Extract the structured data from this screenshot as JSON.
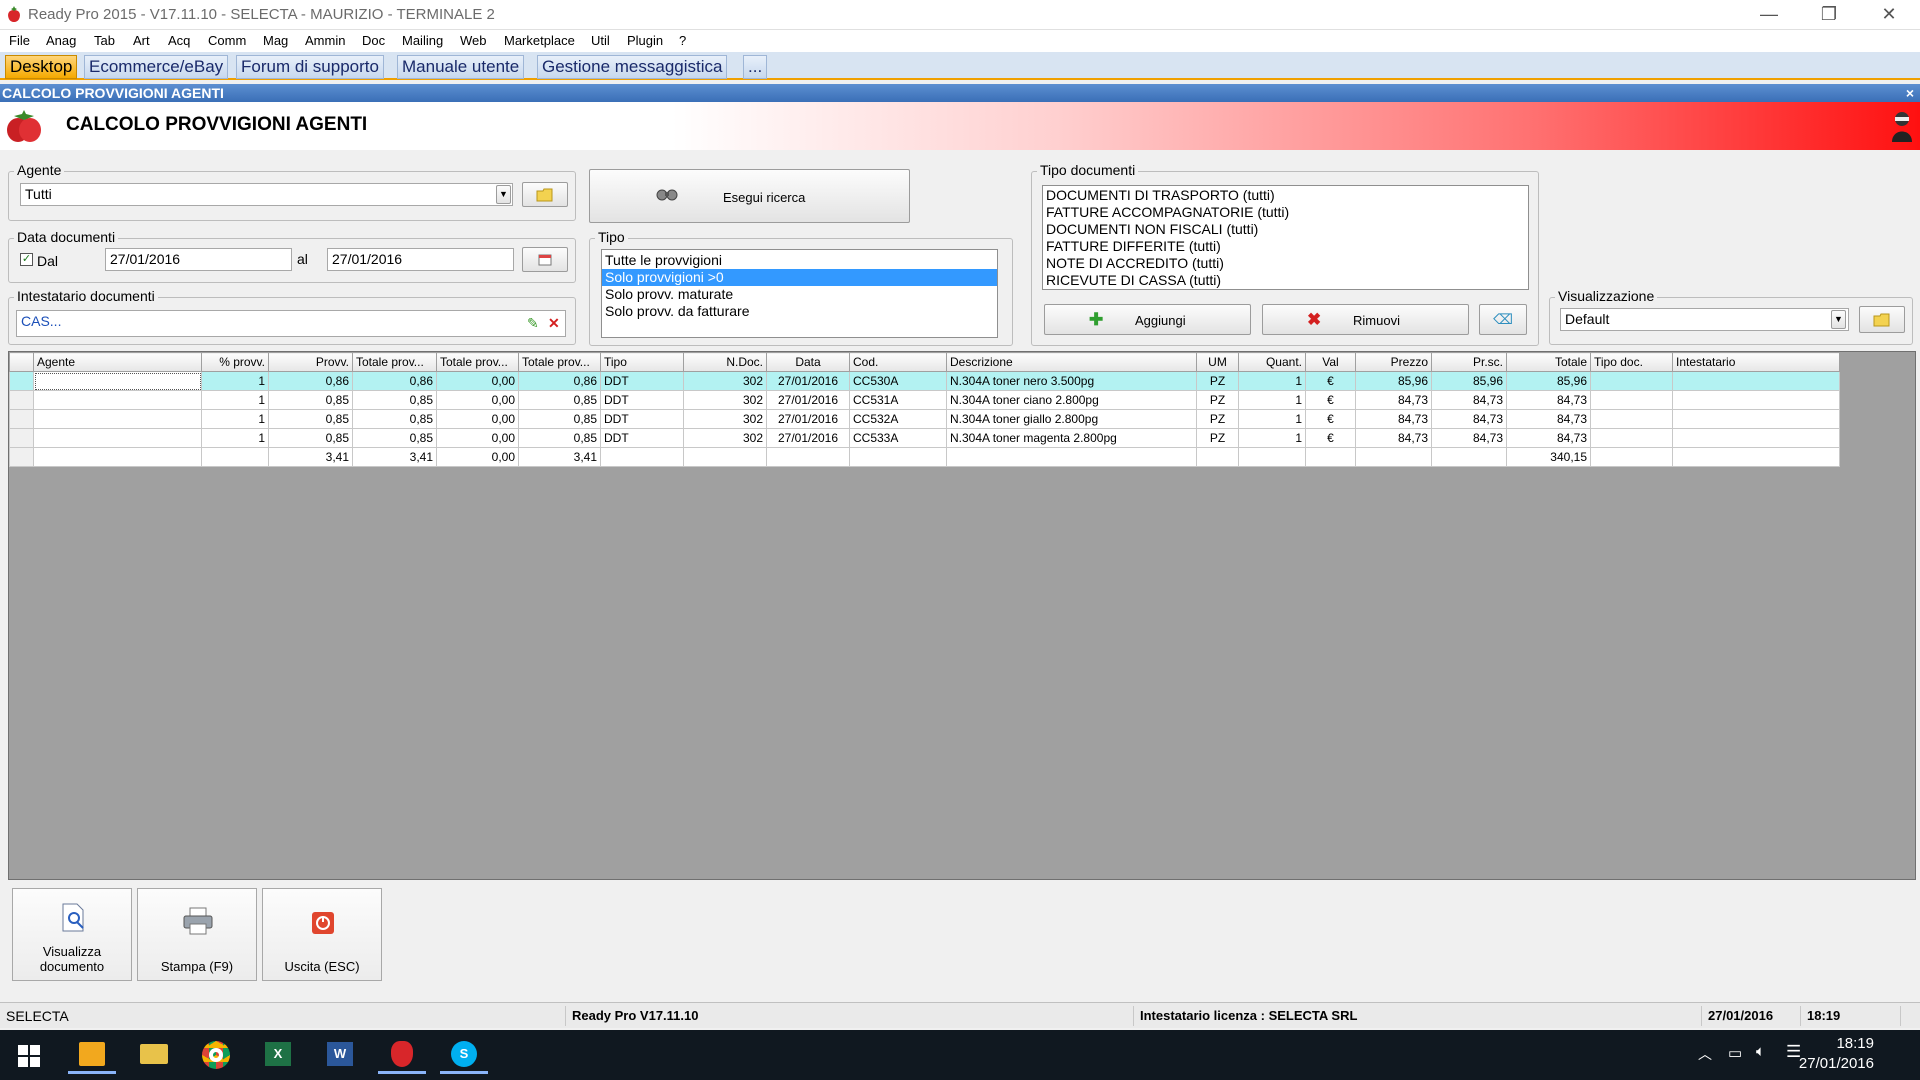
{
  "window": {
    "title": "Ready Pro 2015 - V17.11.10 - SELECTA - MAURIZIO - TERMINALE 2",
    "minimize": "—",
    "restore": "❐",
    "close": "✕"
  },
  "menu": [
    "File",
    "Anag",
    "Tab",
    "Art",
    "Acq",
    "Comm",
    "Mag",
    "Ammin",
    "Doc",
    "Mailing",
    "Web",
    "Marketplace",
    "Util",
    "Plugin",
    "?"
  ],
  "tabs": [
    "Desktop",
    "Ecommerce/eBay",
    "Forum di supporto",
    "Manuale utente",
    "Gestione messaggistica",
    "..."
  ],
  "form_strip": {
    "title": "CALCOLO PROVVIGIONI AGENTI",
    "close": "×"
  },
  "banner": {
    "title": "CALCOLO PROVVIGIONI AGENTI"
  },
  "agente": {
    "label": "Agente",
    "value": "Tutti"
  },
  "data_documenti": {
    "label": "Data documenti",
    "dal_label": "Dal",
    "dal_checked": true,
    "dal_value": "27/01/2016",
    "al_label": "al",
    "al_value": "27/01/2016"
  },
  "intestatario": {
    "label": "Intestatario documenti",
    "value": "CAS..."
  },
  "esegui": {
    "label": "Esegui ricerca"
  },
  "tipo": {
    "label": "Tipo",
    "options": [
      "Tutte le provvigioni",
      "Solo provvigioni >0",
      "Solo provv. maturate",
      "Solo provv. da fatturare"
    ],
    "selected_index": 1
  },
  "tipo_documenti": {
    "label": "Tipo documenti",
    "items": [
      "DOCUMENTI DI TRASPORTO (tutti)",
      "FATTURE ACCOMPAGNATORIE (tutti)",
      "DOCUMENTI NON FISCALI (tutti)",
      "FATTURE DIFFERITE (tutti)",
      "NOTE DI ACCREDITO (tutti)",
      "RICEVUTE DI CASSA (tutti)"
    ],
    "aggiungi": "Aggiungi",
    "rimuovi": "Rimuovi"
  },
  "visualizzazione": {
    "label": "Visualizzazione",
    "value": "Default"
  },
  "grid": {
    "columns": [
      "Agente",
      "% provv.",
      "Provv.",
      "Totale prov...",
      "Totale prov...",
      "Totale prov...",
      "Tipo",
      "N.Doc.",
      "Data",
      "Cod.",
      "Descrizione",
      "UM",
      "Quant.",
      "Val",
      "Prezzo",
      "Pr.sc.",
      "Totale",
      "Tipo doc.",
      "Intestatario"
    ],
    "rows": [
      [
        "",
        "1",
        "0,86",
        "0,86",
        "0,00",
        "0,86",
        "DDT",
        "302",
        "27/01/2016",
        "CC530A",
        "N.304A toner nero 3.500pg",
        "PZ",
        "1",
        "€",
        "85,96",
        "85,96",
        "85,96",
        "",
        ""
      ],
      [
        "",
        "1",
        "0,85",
        "0,85",
        "0,00",
        "0,85",
        "DDT",
        "302",
        "27/01/2016",
        "CC531A",
        "N.304A toner ciano 2.800pg",
        "PZ",
        "1",
        "€",
        "84,73",
        "84,73",
        "84,73",
        "",
        ""
      ],
      [
        "",
        "1",
        "0,85",
        "0,85",
        "0,00",
        "0,85",
        "DDT",
        "302",
        "27/01/2016",
        "CC532A",
        "N.304A toner giallo 2.800pg",
        "PZ",
        "1",
        "€",
        "84,73",
        "84,73",
        "84,73",
        "",
        ""
      ],
      [
        "",
        "1",
        "0,85",
        "0,85",
        "0,00",
        "0,85",
        "DDT",
        "302",
        "27/01/2016",
        "CC533A",
        "N.304A toner magenta 2.800pg",
        "PZ",
        "1",
        "€",
        "84,73",
        "84,73",
        "84,73",
        "",
        ""
      ]
    ],
    "totals": [
      "",
      "",
      "3,41",
      "3,41",
      "0,00",
      "3,41",
      "",
      "",
      "",
      "",
      "",
      "",
      "",
      "",
      "",
      "",
      "340,15",
      "",
      ""
    ]
  },
  "actions": {
    "visualizza": "Visualizza documento",
    "stampa": "Stampa (F9)",
    "uscita": "Uscita (ESC)"
  },
  "statusbar": {
    "company": "SELECTA",
    "version": "Ready Pro V17.11.10",
    "license": "Intestatario licenza : SELECTA SRL",
    "date": "27/01/2016",
    "time": "18:19"
  },
  "taskbar": {
    "time": "18:19",
    "date": "27/01/2016"
  },
  "colors": {
    "tab_active": "#f5a900",
    "selected_row": "#b3f2f2",
    "list_selection": "#3399ff",
    "banner_red": "#ff1010"
  }
}
